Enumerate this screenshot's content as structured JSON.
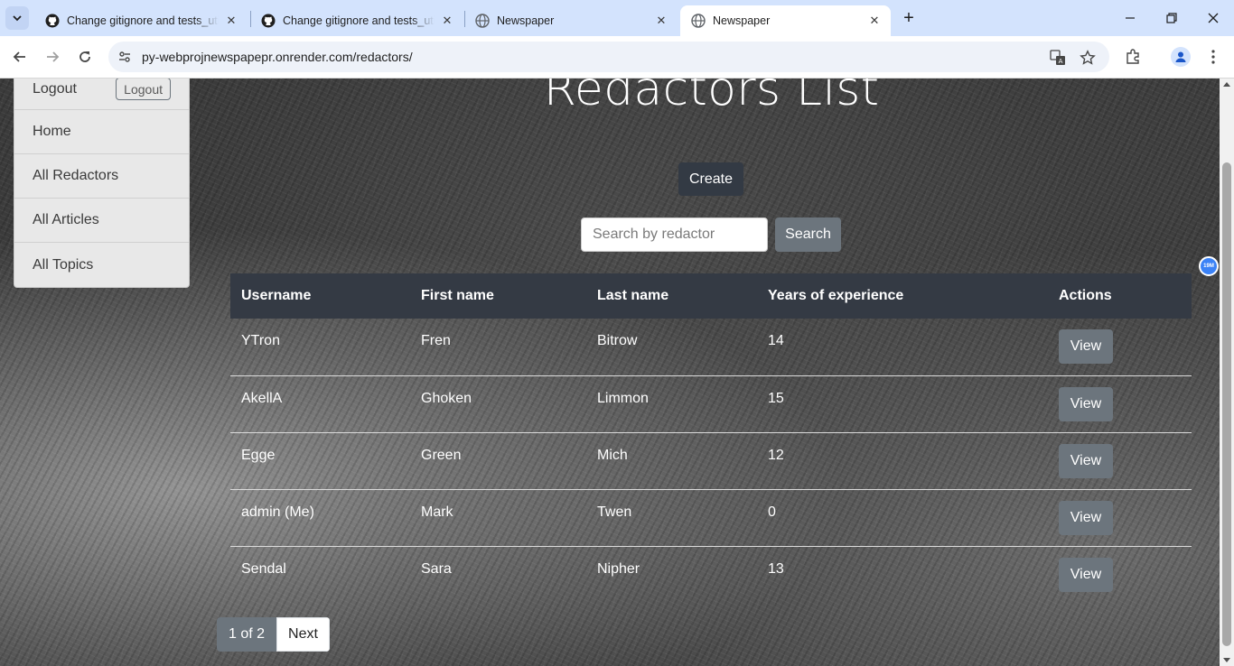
{
  "browser": {
    "tabs": [
      {
        "title": "Change gitignore and tests_util",
        "icon": "github-icon",
        "active": false
      },
      {
        "title": "Change gitignore and tests_util",
        "icon": "github-icon",
        "active": false
      },
      {
        "title": "Newspaper",
        "icon": "globe-icon",
        "active": false
      },
      {
        "title": "Newspaper",
        "icon": "globe-icon",
        "active": true
      }
    ],
    "url": "py-webprojnewspapepr.onrender.com/redactors/"
  },
  "sidebar": {
    "logout_text": "Logout",
    "logout_button": "Logout",
    "items": [
      {
        "label": "Home"
      },
      {
        "label": "All Redactors"
      },
      {
        "label": "All Articles"
      },
      {
        "label": "All Topics"
      }
    ]
  },
  "main": {
    "title": "Redactors List",
    "create_label": "Create",
    "search": {
      "placeholder": "Search by redactor",
      "value": "",
      "button": "Search"
    },
    "badge": "19M"
  },
  "table": {
    "headers": [
      "Username",
      "First name",
      "Last name",
      "Years of experience",
      "Actions"
    ],
    "rows": [
      {
        "username": "YTron",
        "first_name": "Fren",
        "last_name": "Bitrow",
        "years": "14",
        "action": "View"
      },
      {
        "username": "AkellA",
        "first_name": "Ghoken",
        "last_name": "Limmon",
        "years": "15",
        "action": "View"
      },
      {
        "username": "Egge",
        "first_name": "Green",
        "last_name": "Mich",
        "years": "12",
        "action": "View"
      },
      {
        "username": "admin (Me)",
        "first_name": "Mark",
        "last_name": "Twen",
        "years": "0",
        "action": "View"
      },
      {
        "username": "Sendal",
        "first_name": "Sara",
        "last_name": "Nipher",
        "years": "13",
        "action": "View"
      }
    ]
  },
  "pagination": {
    "current": "1 of 2",
    "next": "Next"
  },
  "colors": {
    "dark_button": "#333a44",
    "secondary": "#6c757d",
    "tab_strip": "#d3e3fd"
  }
}
